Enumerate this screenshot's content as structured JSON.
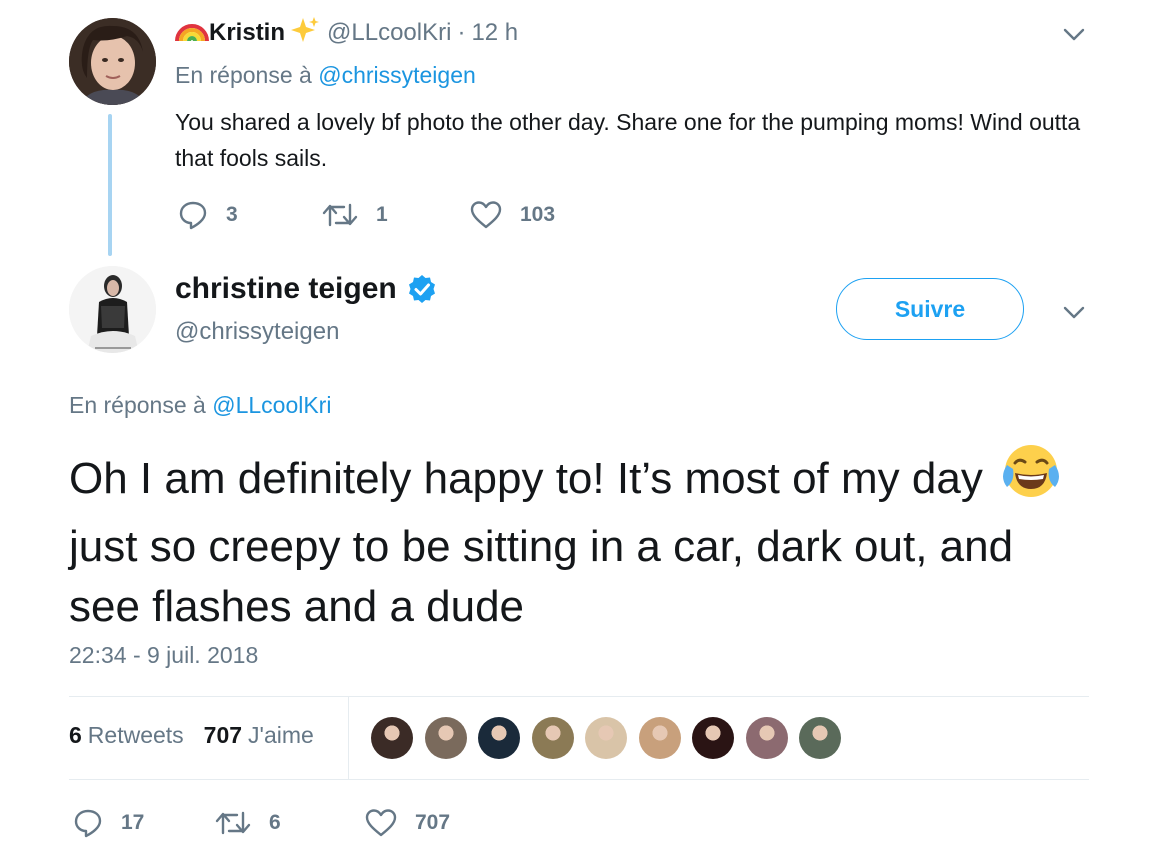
{
  "reply_tweet": {
    "display_name": "Kristin",
    "handle": "@LLcoolKri",
    "separator": "·",
    "time": "12 h",
    "in_reply_prefix": "En réponse à",
    "in_reply_handle": "@chrissyteigen",
    "body": "You shared a lovely bf photo the other day. Share one for the pumping moms! Wind outta that fools sails.",
    "replies": "3",
    "retweets": "1",
    "likes": "103"
  },
  "main_tweet": {
    "display_name": "christine teigen",
    "handle": "@chrissyteigen",
    "follow_label": "Suivre",
    "in_reply_prefix": "En réponse à",
    "in_reply_handle": "@LLcoolKri",
    "body_part1": "Oh I am definitely happy to! It’s most of my day",
    "body_part2": "just so creepy to be sitting in a car, dark out, and see flashes and a dude",
    "timestamp": "22:34 - 9 juil. 2018",
    "retweet_count": "6",
    "retweet_label": "Retweets",
    "like_count": "707",
    "like_label": "J'aime",
    "likers": [
      "#3b2b26",
      "#7a6a5c",
      "#1a2a3a",
      "#8b7a55",
      "#d9c4a8",
      "#c8a07c",
      "#2a1414",
      "#8c6a70",
      "#5a6a5a"
    ],
    "actions": {
      "replies": "17",
      "retweets": "6",
      "likes": "707"
    }
  },
  "colors": {
    "text": "#14171a",
    "secondary": "#657786",
    "link": "#1b95e0",
    "accent": "#1da1f2",
    "thread_line": "#a7d4f2",
    "divider": "#e6ecf0"
  },
  "icons": {
    "rainbow": "rainbow-emoji",
    "sparkles": "sparkles-emoji",
    "verified": "verified-badge-icon",
    "chevron": "chevron-down-icon",
    "reply": "reply-icon",
    "retweet": "retweet-icon",
    "like": "heart-icon",
    "laughing": "face-with-tears-of-joy-emoji"
  }
}
